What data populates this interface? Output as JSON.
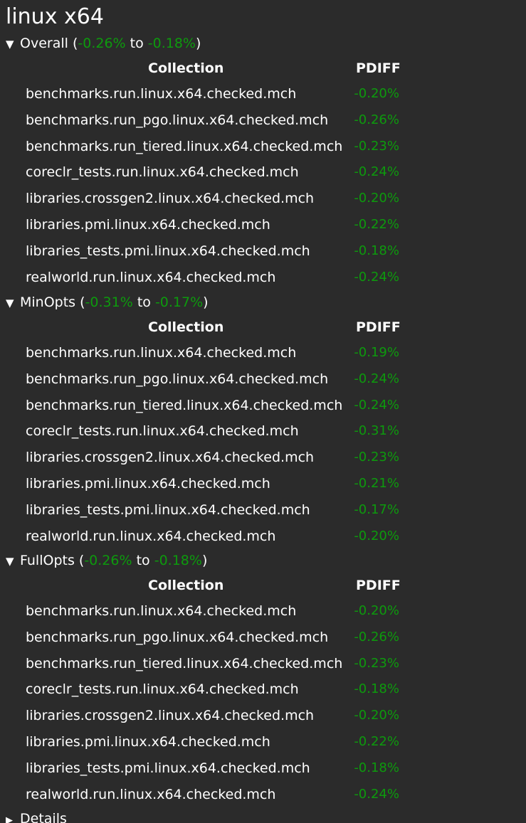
{
  "page_title": "linux x64",
  "columns": {
    "collection": "Collection",
    "pdiff": "PDIFF"
  },
  "sections": [
    {
      "name": "Overall",
      "open_paren": "(",
      "range_min": "-0.26%",
      "to_word": "to",
      "range_max": "-0.18%",
      "close_paren": ")",
      "rows": [
        {
          "collection": "benchmarks.run.linux.x64.checked.mch",
          "pdiff": "-0.20%"
        },
        {
          "collection": "benchmarks.run_pgo.linux.x64.checked.mch",
          "pdiff": "-0.26%"
        },
        {
          "collection": "benchmarks.run_tiered.linux.x64.checked.mch",
          "pdiff": "-0.23%"
        },
        {
          "collection": "coreclr_tests.run.linux.x64.checked.mch",
          "pdiff": "-0.24%"
        },
        {
          "collection": "libraries.crossgen2.linux.x64.checked.mch",
          "pdiff": "-0.20%"
        },
        {
          "collection": "libraries.pmi.linux.x64.checked.mch",
          "pdiff": "-0.22%"
        },
        {
          "collection": "libraries_tests.pmi.linux.x64.checked.mch",
          "pdiff": "-0.18%"
        },
        {
          "collection": "realworld.run.linux.x64.checked.mch",
          "pdiff": "-0.24%"
        }
      ]
    },
    {
      "name": "MinOpts",
      "open_paren": "(",
      "range_min": "-0.31%",
      "to_word": "to",
      "range_max": "-0.17%",
      "close_paren": ")",
      "rows": [
        {
          "collection": "benchmarks.run.linux.x64.checked.mch",
          "pdiff": "-0.19%"
        },
        {
          "collection": "benchmarks.run_pgo.linux.x64.checked.mch",
          "pdiff": "-0.24%"
        },
        {
          "collection": "benchmarks.run_tiered.linux.x64.checked.mch",
          "pdiff": "-0.24%"
        },
        {
          "collection": "coreclr_tests.run.linux.x64.checked.mch",
          "pdiff": "-0.31%"
        },
        {
          "collection": "libraries.crossgen2.linux.x64.checked.mch",
          "pdiff": "-0.23%"
        },
        {
          "collection": "libraries.pmi.linux.x64.checked.mch",
          "pdiff": "-0.21%"
        },
        {
          "collection": "libraries_tests.pmi.linux.x64.checked.mch",
          "pdiff": "-0.17%"
        },
        {
          "collection": "realworld.run.linux.x64.checked.mch",
          "pdiff": "-0.20%"
        }
      ]
    },
    {
      "name": "FullOpts",
      "open_paren": "(",
      "range_min": "-0.26%",
      "to_word": "to",
      "range_max": "-0.18%",
      "close_paren": ")",
      "rows": [
        {
          "collection": "benchmarks.run.linux.x64.checked.mch",
          "pdiff": "-0.20%"
        },
        {
          "collection": "benchmarks.run_pgo.linux.x64.checked.mch",
          "pdiff": "-0.26%"
        },
        {
          "collection": "benchmarks.run_tiered.linux.x64.checked.mch",
          "pdiff": "-0.23%"
        },
        {
          "collection": "coreclr_tests.run.linux.x64.checked.mch",
          "pdiff": "-0.18%"
        },
        {
          "collection": "libraries.crossgen2.linux.x64.checked.mch",
          "pdiff": "-0.20%"
        },
        {
          "collection": "libraries.pmi.linux.x64.checked.mch",
          "pdiff": "-0.22%"
        },
        {
          "collection": "libraries_tests.pmi.linux.x64.checked.mch",
          "pdiff": "-0.18%"
        },
        {
          "collection": "realworld.run.linux.x64.checked.mch",
          "pdiff": "-0.24%"
        }
      ]
    }
  ],
  "details_label": "Details",
  "icons": {
    "expanded": "triangle-down-icon",
    "collapsed": "triangle-right-icon"
  },
  "colors": {
    "background": "#2b2b2b",
    "text": "#ffffff",
    "improvement_green": "#0d9a0d"
  }
}
